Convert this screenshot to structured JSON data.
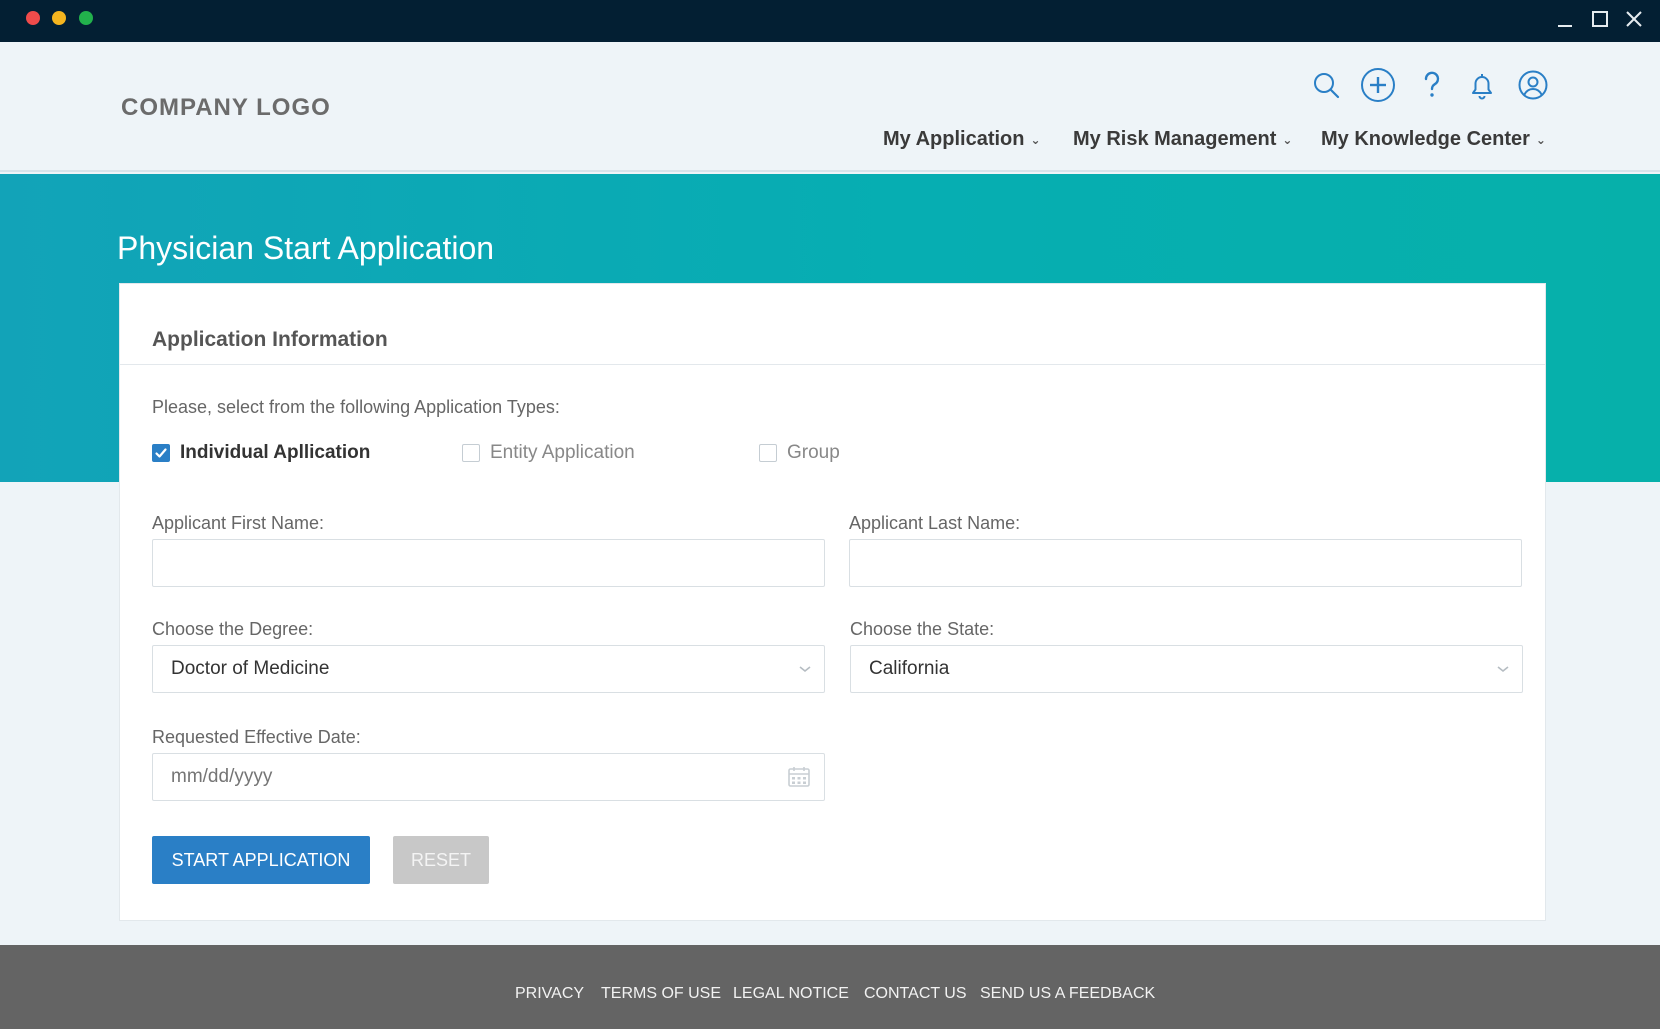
{
  "window": {
    "controls": [
      "minimize-icon",
      "maximize-icon",
      "close-icon"
    ]
  },
  "header": {
    "logo": "COMPANY LOGO",
    "icons": [
      "search-icon",
      "add-circle-icon",
      "help-icon",
      "bell-icon",
      "user-circle-icon"
    ],
    "nav": [
      {
        "label": "My Application"
      },
      {
        "label": "My Risk Management"
      },
      {
        "label": "My Knowledge Center"
      }
    ]
  },
  "banner": {
    "title": "Physician Start Application"
  },
  "card": {
    "title": "Application Information",
    "prompt": "Please, select from the following Application Types:",
    "types": [
      {
        "label": "Individual Apllication",
        "checked": true
      },
      {
        "label": "Entity Application",
        "checked": false
      },
      {
        "label": "Group",
        "checked": false
      }
    ],
    "first_name": {
      "label": "Applicant First Name:",
      "value": "",
      "placeholder": ""
    },
    "last_name": {
      "label": "Applicant Last Name:",
      "value": "",
      "placeholder": ""
    },
    "degree": {
      "label": "Choose the Degree:",
      "selected": "Doctor of Medicine"
    },
    "state": {
      "label": "Choose the State:",
      "selected": "California"
    },
    "date": {
      "label": "Requested Effective Date:",
      "placeholder": "mm/dd/yyyy"
    },
    "start_button": "START APPLICATION",
    "reset_button": "RESET"
  },
  "footer": {
    "links": [
      "PRIVACY",
      "TERMS OF USE",
      "LEGAL NOTICE",
      "CONTACT US",
      "SEND US A FEEDBACK"
    ]
  },
  "colors": {
    "titlebar": "#031f33",
    "banner_start": "#12a3b8",
    "banner_end": "#06b0aa",
    "primary": "#2a7fc6",
    "footer": "#646464"
  }
}
